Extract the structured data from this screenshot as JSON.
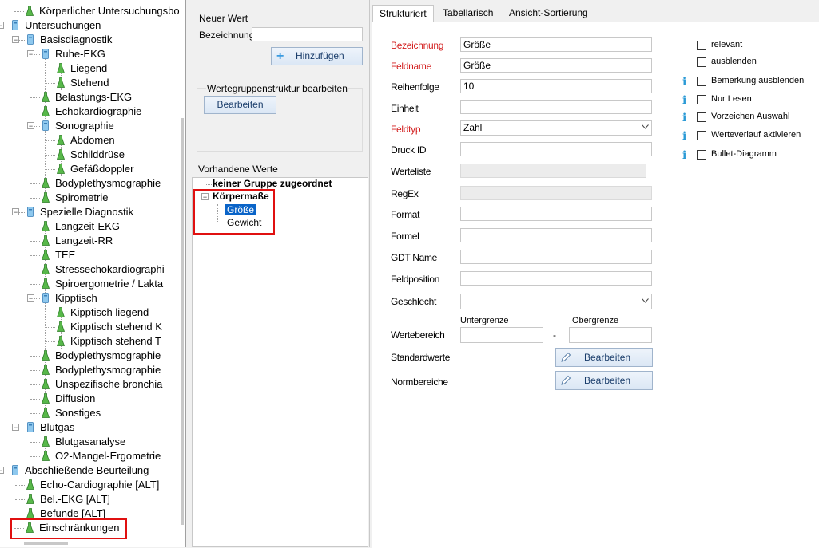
{
  "tree": {
    "nodes": [
      {
        "label": "Körperlicher Untersuchungsbo"
      },
      {
        "label": "Untersuchungen"
      },
      {
        "label": "Basisdiagnostik"
      },
      {
        "label": "Ruhe-EKG"
      },
      {
        "label": "Liegend"
      },
      {
        "label": "Stehend"
      },
      {
        "label": "Belastungs-EKG"
      },
      {
        "label": "Echokardiographie"
      },
      {
        "label": "Sonographie"
      },
      {
        "label": "Abdomen"
      },
      {
        "label": "Schilddrüse"
      },
      {
        "label": "Gefäßdoppler"
      },
      {
        "label": "Bodyplethysmographie"
      },
      {
        "label": "Spirometrie"
      },
      {
        "label": "Spezielle Diagnostik"
      },
      {
        "label": "Langzeit-EKG"
      },
      {
        "label": "Langzeit-RR"
      },
      {
        "label": "TEE"
      },
      {
        "label": "Stressechokardiographi"
      },
      {
        "label": "Spiroergometrie / Lakta"
      },
      {
        "label": "Kipptisch"
      },
      {
        "label": "Kipptisch liegend"
      },
      {
        "label": "Kipptisch stehend K"
      },
      {
        "label": "Kipptisch stehend T"
      },
      {
        "label": "Bodyplethysmographie"
      },
      {
        "label": "Bodyplethysmographie"
      },
      {
        "label": "Unspezifische bronchia"
      },
      {
        "label": "Diffusion"
      },
      {
        "label": "Sonstiges"
      },
      {
        "label": "Blutgas"
      },
      {
        "label": "Blutgasanalyse"
      },
      {
        "label": "O2-Mangel-Ergometrie"
      },
      {
        "label": "Abschließende Beurteilung"
      },
      {
        "label": "Echo-Cardiographie [ALT]"
      },
      {
        "label": "Bel.-EKG [ALT]"
      },
      {
        "label": "Befunde [ALT]"
      },
      {
        "label": "Einschränkungen"
      }
    ]
  },
  "middle": {
    "new_value_heading": "Neuer Wert",
    "name_label": "Bezeichnung",
    "name_value": "",
    "add_button": "Hinzufügen",
    "group_structure_label": "Wertegruppenstruktur bearbeiten",
    "edit_button": "Bearbeiten",
    "existing_values_label": "Vorhandene Werte",
    "values": {
      "ungrouped": "keiner Gruppe zugeordnet",
      "group": "Körpermaße",
      "items": [
        "Größe",
        "Gewicht"
      ]
    }
  },
  "tabs": [
    "Strukturiert",
    "Tabellarisch",
    "Ansicht-Sortierung"
  ],
  "form": {
    "bezeichnung_label": "Bezeichnung",
    "bezeichnung_value": "Größe",
    "feldname_label": "Feldname",
    "feldname_value": "Größe",
    "reihenfolge_label": "Reihenfolge",
    "reihenfolge_value": "10",
    "einheit_label": "Einheit",
    "einheit_value": "",
    "feldtyp_label": "Feldtyp",
    "feldtyp_value": "Zahl",
    "druck_id_label": "Druck ID",
    "druck_id_value": "",
    "werteliste_label": "Werteliste",
    "regex_label": "RegEx",
    "format_label": "Format",
    "format_value": "",
    "formel_label": "Formel",
    "formel_value": "",
    "gdt_name_label": "GDT Name",
    "gdt_name_value": "",
    "feldposition_label": "Feldposition",
    "feldposition_value": "",
    "geschlecht_label": "Geschlecht",
    "geschlecht_value": "",
    "untergrenze_label": "Untergrenze",
    "obergrenze_label": "Obergrenze",
    "wertebereich_label": "Wertebereich",
    "range_separator": "-",
    "standardwerte_label": "Standardwerte",
    "normbereiche_label": "Normbereiche",
    "edit_button": "Bearbeiten"
  },
  "options": [
    {
      "label": "relevant",
      "checked": false,
      "info": false
    },
    {
      "label": "ausblenden",
      "checked": false,
      "info": false
    },
    {
      "label": "Bemerkung ausblenden",
      "checked": false,
      "info": true
    },
    {
      "label": "Nur Lesen",
      "checked": false,
      "info": true
    },
    {
      "label": "Vorzeichen Auswahl",
      "checked": false,
      "info": true
    },
    {
      "label": "Werteverlauf aktivieren",
      "checked": false,
      "info": true
    },
    {
      "label": "Bullet-Diagramm",
      "checked": false,
      "info": true
    }
  ],
  "info_glyph": "i",
  "colors": {
    "required_label": "#d31f1f",
    "highlight": "#e01010",
    "selection": "#0a64c8",
    "info": "#2a9ad6"
  }
}
